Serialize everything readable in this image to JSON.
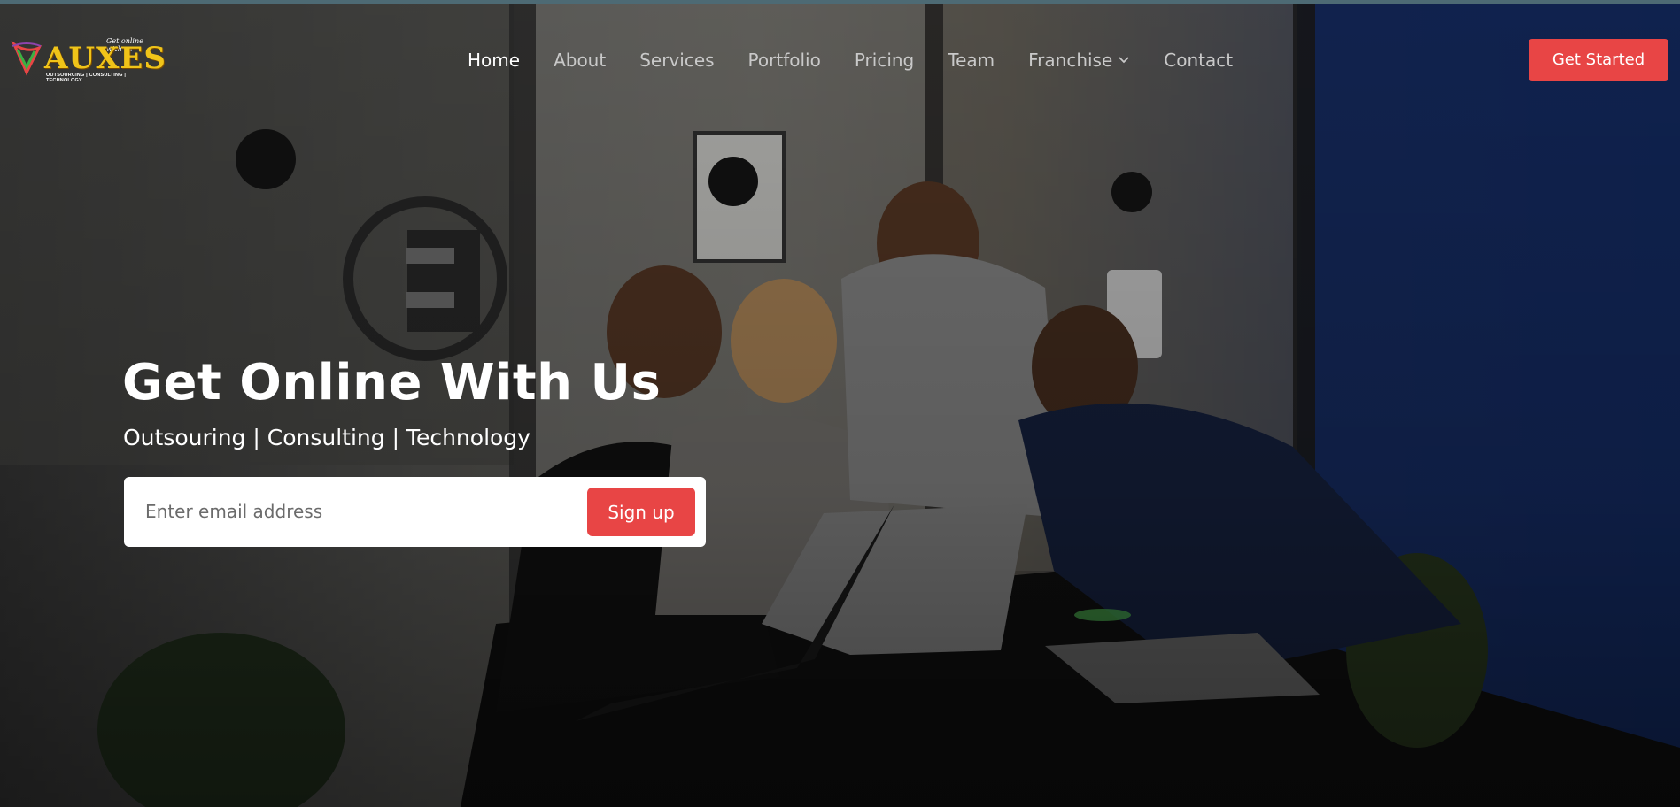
{
  "brand": {
    "name": "AUXES",
    "tagline": "Get online with us",
    "sub": "OUTSOURCING | CONSULTING | TECHNOLOGY",
    "accent_color": "#e84545",
    "logo_color": "#f0c419"
  },
  "nav": {
    "items": [
      {
        "label": "Home",
        "active": true
      },
      {
        "label": "About"
      },
      {
        "label": "Services"
      },
      {
        "label": "Portfolio"
      },
      {
        "label": "Pricing"
      },
      {
        "label": "Team"
      },
      {
        "label": "Franchise",
        "icon": "chevron-down-icon"
      },
      {
        "label": "Contact"
      }
    ],
    "cta_label": "Get Started"
  },
  "hero": {
    "title": "Get Online With Us",
    "subtitle": "Outsouring | Consulting | Technology",
    "email_placeholder": "Enter email address",
    "signup_label": "Sign up"
  }
}
